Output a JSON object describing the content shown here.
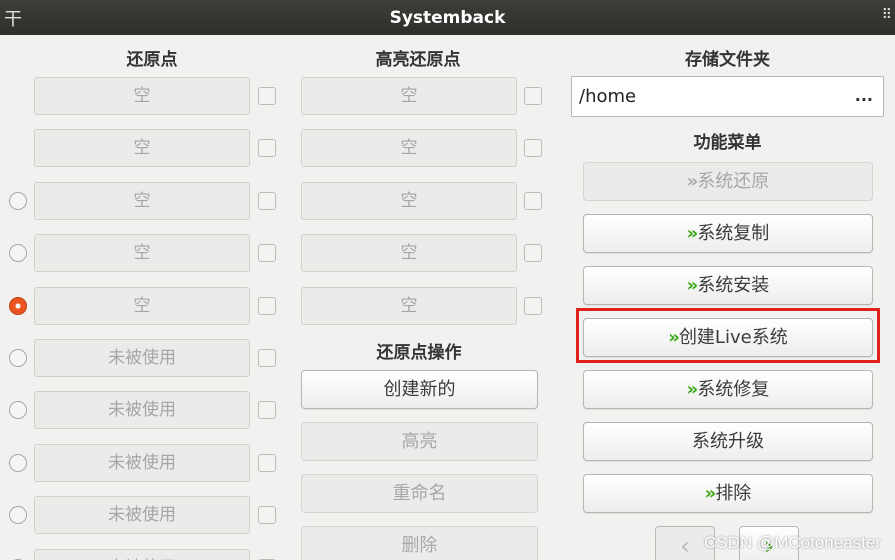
{
  "window": {
    "title": "Systemback",
    "left_icon": "pin-icon",
    "right_icon": "grip-icon"
  },
  "columns": {
    "restore_points_heading": "还原点",
    "highlighted_points_heading": "高亮还原点",
    "storage_heading": "存储文件夹"
  },
  "restore_points": [
    {
      "label": "空",
      "radio": "none"
    },
    {
      "label": "空",
      "radio": "none"
    },
    {
      "label": "空",
      "radio": "off"
    },
    {
      "label": "空",
      "radio": "off"
    },
    {
      "label": "空",
      "radio": "on"
    },
    {
      "label": "未被使用",
      "radio": "off"
    },
    {
      "label": "未被使用",
      "radio": "off"
    },
    {
      "label": "未被使用",
      "radio": "off"
    },
    {
      "label": "未被使用",
      "radio": "off"
    },
    {
      "label": "未被使用",
      "radio": "off"
    }
  ],
  "highlighted_points": [
    {
      "label": "空"
    },
    {
      "label": "空"
    },
    {
      "label": "空"
    },
    {
      "label": "空"
    },
    {
      "label": "空"
    }
  ],
  "restore_ops": {
    "heading": "还原点操作",
    "create_label": "创建新的",
    "highlight_label": "高亮",
    "rename_label": "重命名",
    "delete_label": "删除"
  },
  "storage": {
    "path": "/home",
    "browse_label": "..."
  },
  "function_menu": {
    "heading": "功能菜单",
    "chevron": "»",
    "items": [
      {
        "label": "系统还原",
        "chevron": true,
        "disabled": true
      },
      {
        "label": "系统复制",
        "chevron": true,
        "disabled": false
      },
      {
        "label": "系统安装",
        "chevron": true,
        "disabled": false
      },
      {
        "label": "创建Live系统",
        "chevron": true,
        "disabled": false,
        "highlighted": true
      },
      {
        "label": "系统修复",
        "chevron": true,
        "disabled": false
      },
      {
        "label": "系统升级",
        "chevron": false,
        "disabled": false
      },
      {
        "label": "排除",
        "chevron": true,
        "disabled": false
      }
    ]
  },
  "nav": {
    "prev_icon": "arrow-left-icon",
    "next_icon": "arrow-right-icon"
  },
  "watermark": "CSDN @MCotoneaster",
  "colors": {
    "accent_green": "#3aa614",
    "radio_selected": "#e95420",
    "highlight_border": "#e0201b",
    "titlebar": "#3a3935"
  }
}
